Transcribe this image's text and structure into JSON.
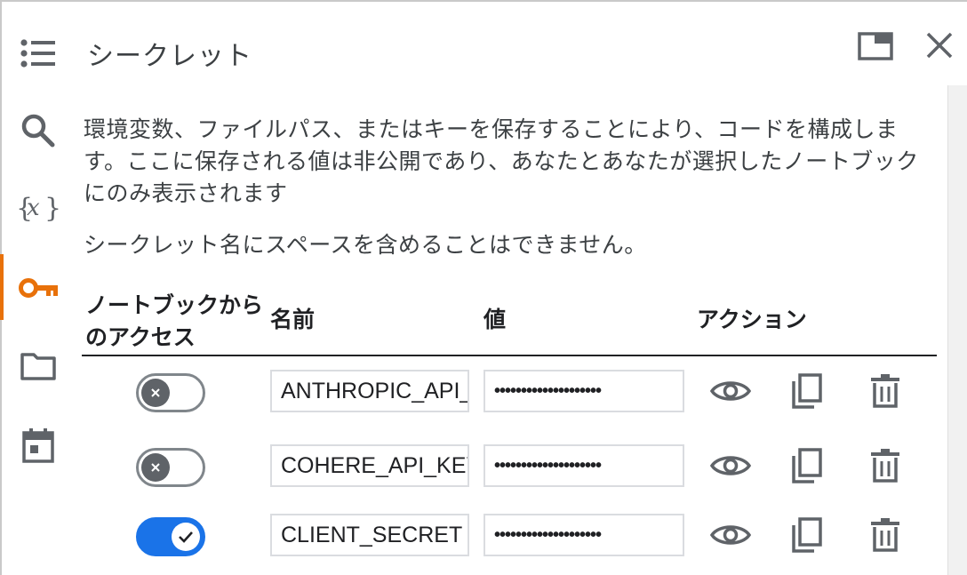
{
  "panel": {
    "title": "シークレット",
    "description": "環境変数、ファイルパス、またはキーを保存することにより、コードを構成します。ここに保存される値は非公開であり、あなたとあなたが選択したノートブックにのみ表示されます",
    "note": "シークレット名にスペースを含めることはできません。"
  },
  "table": {
    "headers": {
      "access": "ノートブックからのアクセス",
      "name": "名前",
      "value": "値",
      "action": "アクション"
    },
    "rows": [
      {
        "access": "off",
        "name": "ANTHROPIC_API_KEY",
        "value": "••••••••••••••••••••"
      },
      {
        "access": "off",
        "name": "COHERE_API_KEY",
        "value": "••••••••••••••••••••"
      },
      {
        "access": "on",
        "name": "CLIENT_SECRET",
        "value": "••••••••••••••••••••"
      }
    ]
  },
  "rail": {
    "items": [
      "list-icon",
      "search-icon",
      "variables-icon",
      "key-icon",
      "folder-icon",
      "calendar-icon"
    ],
    "active": "key-icon",
    "active_color": "#e8710a"
  },
  "colors": {
    "toggle_on": "#1a73e8",
    "toggle_off": "#5f6368",
    "icon": "#5f6368"
  }
}
